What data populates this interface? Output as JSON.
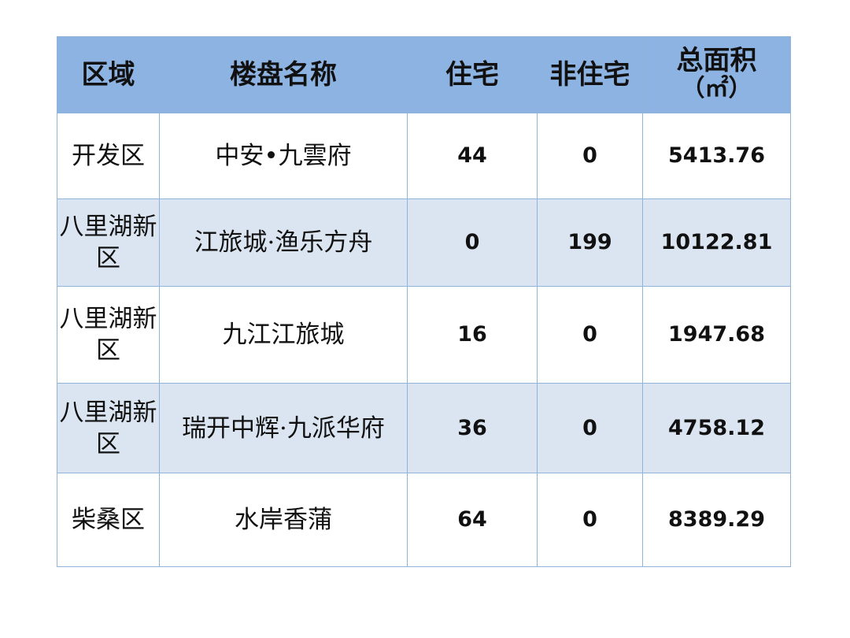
{
  "table": {
    "headers": {
      "region": "区域",
      "project": "楼盘名称",
      "residential": "住宅",
      "non_residential": "非住宅",
      "total_area_line1": "总面积",
      "total_area_line2": "（㎡）"
    },
    "rows": [
      {
        "region": "开发区",
        "project": "中安•九雲府",
        "residential": "44",
        "non_residential": "0",
        "total_area": "5413.76"
      },
      {
        "region": "八里湖新区",
        "project": "江旅城·渔乐方舟",
        "residential": "0",
        "non_residential": "199",
        "total_area": "10122.81"
      },
      {
        "region": "八里湖新区",
        "project": "九江江旅城",
        "residential": "16",
        "non_residential": "0",
        "total_area": "1947.68"
      },
      {
        "region": "八里湖新区",
        "project": "瑞开中辉·九派华府",
        "residential": "36",
        "non_residential": "0",
        "total_area": "4758.12"
      },
      {
        "region": "柴桑区",
        "project": "水岸香蒲",
        "residential": "64",
        "non_residential": "0",
        "total_area": "8389.29"
      }
    ]
  },
  "colors": {
    "header_bg": "#8db3e2",
    "row_alt_bg": "#dbe5f1",
    "border": "#8fb3d9"
  }
}
